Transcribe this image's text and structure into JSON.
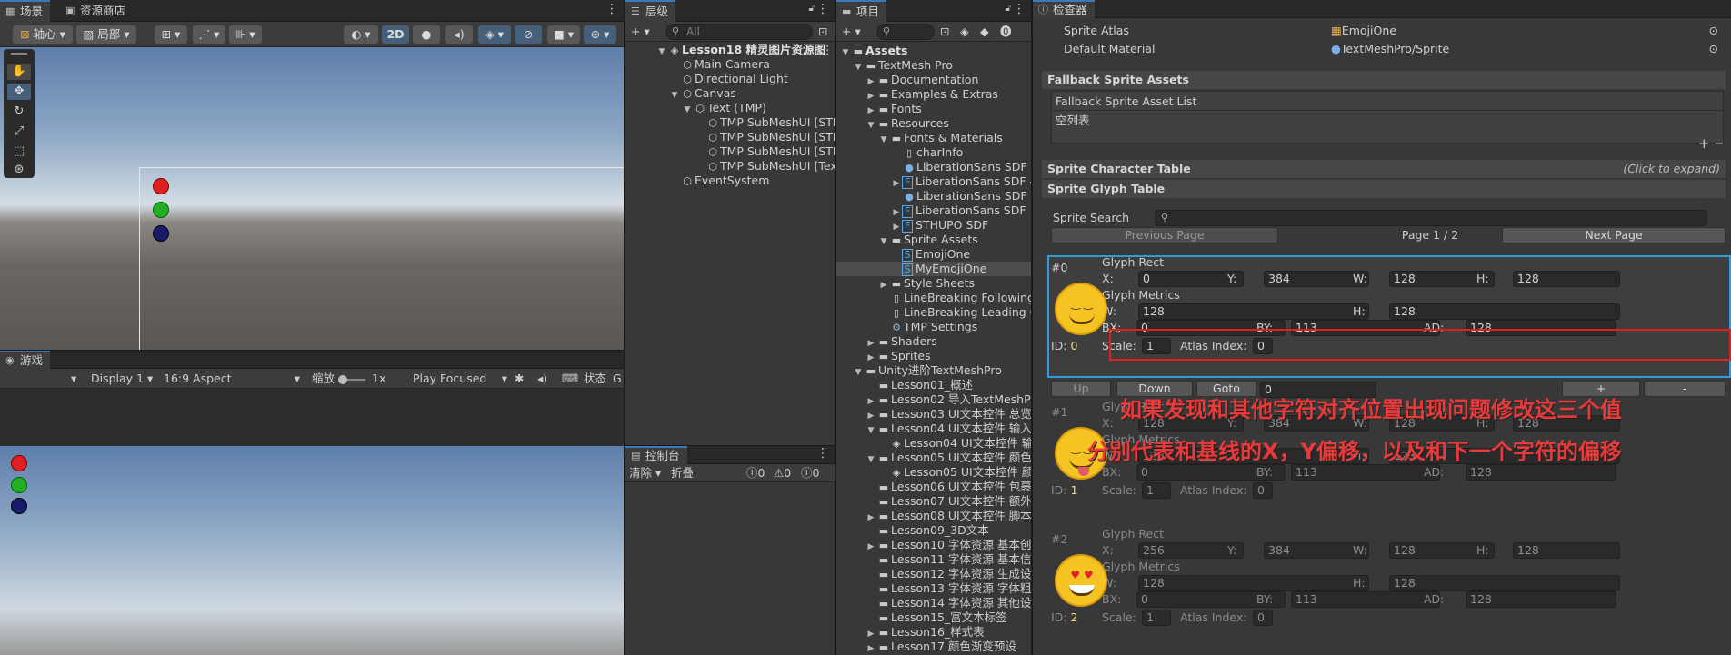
{
  "scene_panel": {
    "tabs": [
      {
        "label": "场景",
        "icon": "grid-icon"
      },
      {
        "label": "资源商店",
        "icon": "store-icon"
      }
    ],
    "toolbar": {
      "pivot": "轴心",
      "local": "局部",
      "mode_2d": "2D"
    },
    "colors": {
      "ball1": "#e02020",
      "ball2": "#20b020",
      "ball3": "#1a1a6a"
    }
  },
  "game_panel": {
    "tab": "游戏",
    "display": "Display 1",
    "aspect": "16:9 Aspect",
    "scale_label": "缩放",
    "scale_value": "1x",
    "play_mode": "Play Focused",
    "stats": "状态",
    "gizmos": "G"
  },
  "hierarchy": {
    "tab": "层级",
    "search_placeholder": "All",
    "items": [
      {
        "label": "Lesson18 精灵图片资源图",
        "depth": 0,
        "arrow": "▼",
        "icon": "unity",
        "bold": true
      },
      {
        "label": "Main Camera",
        "depth": 1,
        "arrow": "",
        "icon": "cube"
      },
      {
        "label": "Directional Light",
        "depth": 1,
        "arrow": "",
        "icon": "cube"
      },
      {
        "label": "Canvas",
        "depth": 1,
        "arrow": "▼",
        "icon": "cube"
      },
      {
        "label": "Text (TMP)",
        "depth": 2,
        "arrow": "▼",
        "icon": "cube"
      },
      {
        "label": "TMP SubMeshUI [STH",
        "depth": 3,
        "arrow": "",
        "icon": "cube"
      },
      {
        "label": "TMP SubMeshUI [STH",
        "depth": 3,
        "arrow": "",
        "icon": "cube"
      },
      {
        "label": "TMP SubMeshUI [STH",
        "depth": 3,
        "arrow": "",
        "icon": "cube"
      },
      {
        "label": "TMP SubMeshUI [Tex",
        "depth": 3,
        "arrow": "",
        "icon": "cube"
      },
      {
        "label": "EventSystem",
        "depth": 1,
        "arrow": "",
        "icon": "cube"
      }
    ]
  },
  "console": {
    "tab": "控制台",
    "clear": "清除",
    "collapse": "折叠",
    "count_log": "0",
    "count_warn": "0",
    "count_err": "0"
  },
  "project": {
    "tab": "项目",
    "items": [
      {
        "label": "Assets",
        "depth": 0,
        "arrow": "▼",
        "icon": "folder",
        "bold": true
      },
      {
        "label": "TextMesh Pro",
        "depth": 1,
        "arrow": "▼",
        "icon": "folder"
      },
      {
        "label": "Documentation",
        "depth": 2,
        "arrow": "▶",
        "icon": "folder"
      },
      {
        "label": "Examples & Extras",
        "depth": 2,
        "arrow": "▶",
        "icon": "folder"
      },
      {
        "label": "Fonts",
        "depth": 2,
        "arrow": "▶",
        "icon": "folder"
      },
      {
        "label": "Resources",
        "depth": 2,
        "arrow": "▼",
        "icon": "folder"
      },
      {
        "label": "Fonts & Materials",
        "depth": 3,
        "arrow": "▼",
        "icon": "folder"
      },
      {
        "label": "charInfo",
        "depth": 4,
        "arrow": "",
        "icon": "doc"
      },
      {
        "label": "LiberationSans SDF -",
        "depth": 4,
        "arrow": "",
        "icon": "mat"
      },
      {
        "label": "LiberationSans SDF -",
        "depth": 4,
        "arrow": "▶",
        "icon": "font"
      },
      {
        "label": "LiberationSans SDF -",
        "depth": 4,
        "arrow": "",
        "icon": "mat"
      },
      {
        "label": "LiberationSans SDF",
        "depth": 4,
        "arrow": "▶",
        "icon": "font"
      },
      {
        "label": "STHUPO SDF",
        "depth": 4,
        "arrow": "▶",
        "icon": "font"
      },
      {
        "label": "Sprite Assets",
        "depth": 3,
        "arrow": "▼",
        "icon": "folder"
      },
      {
        "label": "EmojiOne",
        "depth": 4,
        "arrow": "",
        "icon": "sprite"
      },
      {
        "label": "MyEmojiOne",
        "depth": 4,
        "arrow": "",
        "icon": "sprite",
        "selected": true
      },
      {
        "label": "Style Sheets",
        "depth": 3,
        "arrow": "▶",
        "icon": "folder"
      },
      {
        "label": "LineBreaking Following",
        "depth": 3,
        "arrow": "",
        "icon": "doc"
      },
      {
        "label": "LineBreaking Leading C",
        "depth": 3,
        "arrow": "",
        "icon": "doc"
      },
      {
        "label": "TMP Settings",
        "depth": 3,
        "arrow": "",
        "icon": "settings"
      },
      {
        "label": "Shaders",
        "depth": 2,
        "arrow": "▶",
        "icon": "folder"
      },
      {
        "label": "Sprites",
        "depth": 2,
        "arrow": "▶",
        "icon": "folder"
      },
      {
        "label": "Unity进阶TextMeshPro",
        "depth": 1,
        "arrow": "▼",
        "icon": "folder"
      },
      {
        "label": "Lesson01_概述",
        "depth": 2,
        "arrow": "",
        "icon": "folder"
      },
      {
        "label": "Lesson02 导入TextMeshPr",
        "depth": 2,
        "arrow": "▶",
        "icon": "folder"
      },
      {
        "label": "Lesson03 UI文本控件 总览",
        "depth": 2,
        "arrow": "▶",
        "icon": "folder"
      },
      {
        "label": "Lesson04 UI文本控件 输入",
        "depth": 2,
        "arrow": "▼",
        "icon": "folder"
      },
      {
        "label": "Lesson04 UI文本控件 输",
        "depth": 3,
        "arrow": "",
        "icon": "unity"
      },
      {
        "label": "Lesson05 UI文本控件 颜色",
        "depth": 2,
        "arrow": "▼",
        "icon": "folder"
      },
      {
        "label": "Lesson05 UI文本控件 颜",
        "depth": 3,
        "arrow": "",
        "icon": "unity"
      },
      {
        "label": "Lesson06 UI文本控件 包裹",
        "depth": 2,
        "arrow": "",
        "icon": "folder"
      },
      {
        "label": "Lesson07 UI文本控件 额外",
        "depth": 2,
        "arrow": "",
        "icon": "folder"
      },
      {
        "label": "Lesson08 UI文本控件 脚本",
        "depth": 2,
        "arrow": "▶",
        "icon": "folder"
      },
      {
        "label": "Lesson09_3D文本",
        "depth": 2,
        "arrow": "",
        "icon": "folder"
      },
      {
        "label": "Lesson10 字体资源 基本创",
        "depth": 2,
        "arrow": "▶",
        "icon": "folder"
      },
      {
        "label": "Lesson11 字体资源 基本信",
        "depth": 2,
        "arrow": "",
        "icon": "folder"
      },
      {
        "label": "Lesson12 字体资源 生成设",
        "depth": 2,
        "arrow": "",
        "icon": "folder"
      },
      {
        "label": "Lesson13 字体资源 字体粗",
        "depth": 2,
        "arrow": "",
        "icon": "folder"
      },
      {
        "label": "Lesson14 字体资源 其他设",
        "depth": 2,
        "arrow": "",
        "icon": "folder"
      },
      {
        "label": "Lesson15_富文本标签",
        "depth": 2,
        "arrow": "",
        "icon": "folder"
      },
      {
        "label": "Lesson16_样式表",
        "depth": 2,
        "arrow": "▶",
        "icon": "folder"
      },
      {
        "label": "Lesson17 颜色渐变预设",
        "depth": 2,
        "arrow": "▶",
        "icon": "folder"
      }
    ]
  },
  "inspector": {
    "tab": "检查器",
    "sprite_atlas_label": "Sprite Atlas",
    "sprite_atlas_value": "EmojiOne",
    "default_material_label": "Default Material",
    "default_material_value": "TextMeshPro/Sprite",
    "fallback_header": "Fallback Sprite Assets",
    "fallback_list_label": "Fallback Sprite Asset List",
    "empty_list": "空列表",
    "plus": "+",
    "minus": "−",
    "char_table_header": "Sprite Character Table",
    "click_to_expand": "(Click to expand)",
    "glyph_table_header": "Sprite Glyph Table",
    "sprite_search_label": "Sprite Search",
    "prev_page": "Previous Page",
    "page_info": "Page 1 / 2",
    "next_page": "Next Page",
    "glyph_rect_label": "Glyph Rect",
    "glyph_metrics_label": "Glyph Metrics",
    "scale_label": "Scale:",
    "atlas_index_label": "Atlas Index:",
    "up_button": "Up",
    "down_button": "Down",
    "goto_button": "Goto",
    "goto_value": "0",
    "add_button": "+",
    "remove_button": "-",
    "glyphs": [
      {
        "index": "#0",
        "id_label": "ID:",
        "id": "0",
        "x": "0",
        "y": "384",
        "w": "128",
        "h": "128",
        "mw": "128",
        "mh": "128",
        "bx": "0",
        "by": "113",
        "ad": "128",
        "scale": "1",
        "atlas": "0",
        "face": "smile"
      },
      {
        "index": "#1",
        "id_label": "ID:",
        "id": "1",
        "x": "128",
        "y": "384",
        "w": "128",
        "h": "128",
        "mw": "128",
        "mh": "128",
        "bx": "0",
        "by": "113",
        "ad": "128",
        "scale": "1",
        "atlas": "0",
        "face": "tongue"
      },
      {
        "index": "#2",
        "id_label": "ID:",
        "id": "2",
        "x": "256",
        "y": "384",
        "w": "128",
        "h": "128",
        "mw": "128",
        "mh": "128",
        "bx": "0",
        "by": "113",
        "ad": "128",
        "scale": "1",
        "atlas": "0",
        "face": "hearts"
      }
    ]
  },
  "annotation": {
    "line1": "如果发现和其他字符对齐位置出现问题修改这三个值",
    "line2": "分别代表和基线的X，Y偏移，以及和下一个字符的偏移",
    "color": "#e83a3a"
  },
  "accent": "#3a79bb"
}
